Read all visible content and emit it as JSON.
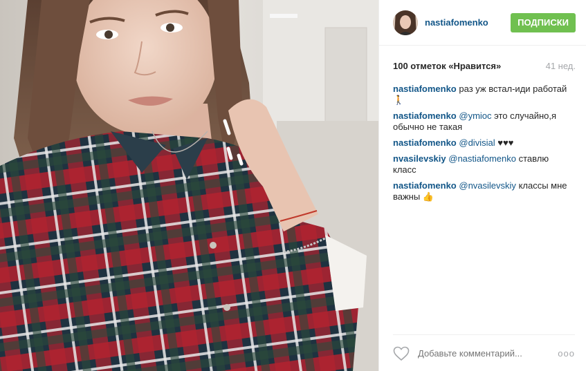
{
  "post": {
    "author": "nastiafomenko",
    "follow_label": "ПОДПИСКИ",
    "likes_text": "100 отметок «Нравится»",
    "time_ago": "41 нед."
  },
  "comments": [
    {
      "user": "nastiafomenko",
      "mention": "",
      "text": "раз уж встал-иди работай 🚶"
    },
    {
      "user": "nastiafomenko",
      "mention": "@ymioc",
      "text": "это случайно,я обычно не такая"
    },
    {
      "user": "nastiafomenko",
      "mention": "@divisial",
      "text": "♥♥♥"
    },
    {
      "user": "nvasilevskiy",
      "mention": "@nastiafomenko",
      "text": "ставлю класс"
    },
    {
      "user": "nastiafomenko",
      "mention": "@nvasilevskiy",
      "text": "классы мне важны 👍"
    }
  ],
  "footer": {
    "comment_placeholder": "Добавьте комментарий...",
    "more_label": "ооо"
  },
  "icons": {
    "like": "heart-outline-icon",
    "more": "more-options-icon"
  },
  "colors": {
    "link": "#125688",
    "follow_button": "#70c050",
    "muted": "#a5a7aa"
  }
}
